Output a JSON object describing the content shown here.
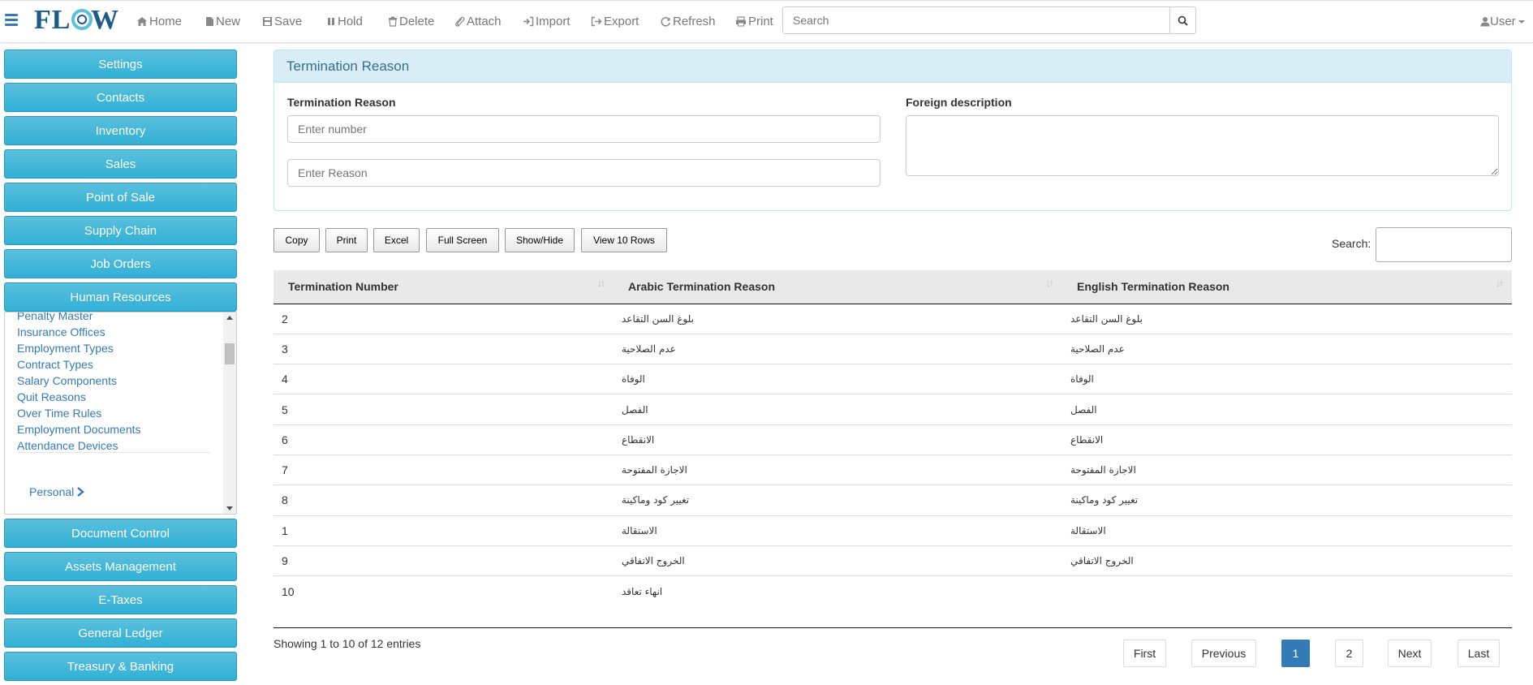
{
  "app": {
    "logo_text": "FLOW",
    "accent": "#337ab7",
    "module_color": "#5bc0de"
  },
  "nav": {
    "home": "Home",
    "new": "New",
    "save": "Save",
    "hold": "Hold",
    "delete": "Delete",
    "attach": "Attach",
    "import": "Import",
    "export": "Export",
    "refresh": "Refresh",
    "print": "Print",
    "search_placeholder": "Search",
    "user": "User"
  },
  "sidebar": {
    "modules_top": [
      "Settings",
      "Contacts",
      "Inventory",
      "Sales",
      "Point of Sale",
      "Supply Chain",
      "Job Orders",
      "Human Resources"
    ],
    "submenu": [
      "Penalty Master",
      "Insurance Offices",
      "Employment Types",
      "Contract Types",
      "Salary Components",
      "Quit Reasons",
      "Over Time Rules",
      "Employment Documents",
      "Attendance Devices"
    ],
    "submenu_personal": "Personal",
    "modules_bottom": [
      "Document Control",
      "Assets Management",
      "E-Taxes",
      "General Ledger",
      "Treasury & Banking"
    ]
  },
  "panel": {
    "title": "Termination Reason",
    "label_reason": "Termination Reason",
    "placeholder_number": "Enter number",
    "placeholder_reason": "Enter Reason",
    "label_foreign": "Foreign description"
  },
  "table_buttons": [
    "Copy",
    "Print",
    "Excel",
    "Full Screen",
    "Show/Hide",
    "View 10 Rows"
  ],
  "table_search_label": "Search:",
  "table": {
    "headers": [
      "Termination Number",
      "Arabic Termination Reason",
      "English Termination Reason"
    ],
    "rows": [
      [
        "2",
        "بلوغ السن التقاعد",
        "بلوغ السن التقاعد"
      ],
      [
        "3",
        "عدم الصلاحية",
        "عدم الصلاحية"
      ],
      [
        "4",
        "الوفاة",
        "الوفاة"
      ],
      [
        "5",
        "الفصل",
        "الفصل"
      ],
      [
        "6",
        "الانقطاع",
        "الانقطاع"
      ],
      [
        "7",
        "الاجازة المفتوحة",
        "الاجازة المفتوحة"
      ],
      [
        "8",
        "تغيير كود وماكينة",
        "تغيير كود وماكينة"
      ],
      [
        "1",
        "الاستقالة",
        "الاستقالة"
      ],
      [
        "9",
        "الخروج الاتفاقي",
        "الخروج الاتفاقي"
      ],
      [
        "10",
        "انهاء تعاقد",
        ""
      ]
    ]
  },
  "pagination": {
    "info": "Showing 1 to 10 of 12 entries",
    "first": "First",
    "previous": "Previous",
    "page1": "1",
    "page2": "2",
    "next": "Next",
    "last": "Last"
  }
}
